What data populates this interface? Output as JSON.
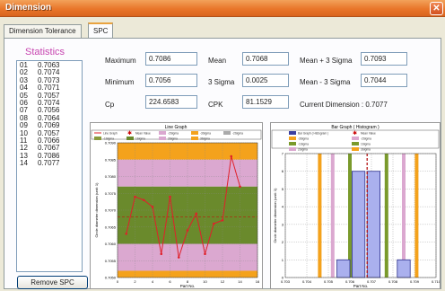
{
  "window": {
    "title": "Dimension",
    "close_glyph": "✕"
  },
  "tabs": [
    {
      "label": "Dimension Tolerance"
    },
    {
      "label": "SPC"
    }
  ],
  "statistics": {
    "title": "Statistics",
    "items": [
      {
        "idx": "01",
        "value": "0.7063"
      },
      {
        "idx": "02",
        "value": "0.7074"
      },
      {
        "idx": "03",
        "value": "0.7073"
      },
      {
        "idx": "04",
        "value": "0.7071"
      },
      {
        "idx": "05",
        "value": "0.7057"
      },
      {
        "idx": "06",
        "value": "0.7074"
      },
      {
        "idx": "07",
        "value": "0.7056"
      },
      {
        "idx": "08",
        "value": "0.7064"
      },
      {
        "idx": "09",
        "value": "0.7069"
      },
      {
        "idx": "10",
        "value": "0.7057"
      },
      {
        "idx": "11",
        "value": "0.7066"
      },
      {
        "idx": "12",
        "value": "0.7067"
      },
      {
        "idx": "13",
        "value": "0.7086"
      },
      {
        "idx": "14",
        "value": "0.7077"
      }
    ],
    "remove_label": "Remove SPC"
  },
  "metrics": {
    "maximum": {
      "label": "Maximum",
      "value": "0.7086"
    },
    "minimum": {
      "label": "Minimum",
      "value": "0.7056"
    },
    "cp": {
      "label": "Cp",
      "value": "224.6583"
    },
    "mean": {
      "label": "Mean",
      "value": "0.7068"
    },
    "sigma3": {
      "label": "3 Sigma",
      "value": "0.0025"
    },
    "cpk": {
      "label": "CPK",
      "value": "81.1529"
    },
    "mean_plus": {
      "label": "Mean + 3 Sigma",
      "value": "0.7093"
    },
    "mean_minus": {
      "label": "Mean - 3 Sigma",
      "value": "0.7044"
    },
    "current": {
      "label": "Current Dimension : 0.7077"
    }
  },
  "chart_data": [
    {
      "type": "line",
      "title": "Line Graph",
      "xlabel": "Part No.",
      "ylabel": "Circle diameter dimension (unit: 1)",
      "xlim": [
        0,
        16
      ],
      "ylim": [
        0.705,
        0.709
      ],
      "x_ticks": [
        "0",
        "2",
        "4",
        "6",
        "8",
        "10",
        "12",
        "14",
        "16"
      ],
      "y_ticks": [
        "0.7090",
        "0.7085",
        "0.7080",
        "0.7075",
        "0.7070",
        "0.7065",
        "0.7060",
        "0.7055",
        "0.7050"
      ],
      "x": [
        1,
        2,
        3,
        4,
        5,
        6,
        7,
        8,
        9,
        10,
        11,
        12,
        13,
        14
      ],
      "series": [
        {
          "name": "Line Graph",
          "values": [
            0.7063,
            0.7074,
            0.7073,
            0.7071,
            0.7057,
            0.7074,
            0.7056,
            0.7064,
            0.7069,
            0.7057,
            0.7066,
            0.7067,
            0.7086,
            0.7077
          ],
          "color": "#e0202a"
        }
      ],
      "mean_line": 0.7068,
      "bands": [
        {
          "from": 0.7085,
          "to": 0.709,
          "color": "#f4a21c"
        },
        {
          "from": 0.7077,
          "to": 0.7085,
          "color": "#dba8d0"
        },
        {
          "from": 0.706,
          "to": 0.7077,
          "color": "#6a8a2c"
        },
        {
          "from": 0.7052,
          "to": 0.706,
          "color": "#dba8d0"
        },
        {
          "from": 0.705,
          "to": 0.7052,
          "color": "#f4a21c"
        }
      ],
      "legend": [
        {
          "label": "Line Graph",
          "color": "#e0202a",
          "kind": "line"
        },
        {
          "label": "Mean Value",
          "color": "#cc0000",
          "kind": "marker"
        },
        {
          "label": "-2Sigma",
          "color": "#dba8d0",
          "kind": "swatch"
        },
        {
          "label": "-3Sigma",
          "color": "#f4a21c",
          "kind": "swatch"
        },
        {
          "label": "-2Sigma",
          "color": "#aaaaaa",
          "kind": "swatch"
        },
        {
          "label": "-1Sigma",
          "color": "#8a9a3c",
          "kind": "swatch"
        },
        {
          "label": "1Sigma",
          "color": "#6a8a2c",
          "kind": "swatch"
        },
        {
          "label": "2Sigma",
          "color": "#dba8d0",
          "kind": "swatch"
        },
        {
          "label": "3Sigma",
          "color": "#f4a21c",
          "kind": "swatch"
        }
      ]
    },
    {
      "type": "bar",
      "title": "Bar Graph ( Histogram )",
      "xlabel": "Part No.",
      "ylabel": "Circle diameter dimension (unit: 1)",
      "xlim": [
        0.703,
        0.71
      ],
      "ylim": [
        0,
        7
      ],
      "x_ticks": [
        "0.703",
        "0.704",
        "0.705",
        "0.706",
        "0.707",
        "0.708",
        "0.709",
        "0.710"
      ],
      "y_ticks": [
        "7",
        "6",
        "5",
        "4",
        "3",
        "2",
        "1",
        "0"
      ],
      "bins": [
        {
          "center": 0.7057,
          "count": 1
        },
        {
          "center": 0.7064,
          "count": 6
        },
        {
          "center": 0.7071,
          "count": 6
        },
        {
          "center": 0.7085,
          "count": 1
        }
      ],
      "mean_line": 0.7068,
      "sigma_lines": [
        {
          "x": 0.7046,
          "color": "#f4a21c"
        },
        {
          "x": 0.7052,
          "color": "#dba8d0"
        },
        {
          "x": 0.706,
          "color": "#7a9a2c"
        },
        {
          "x": 0.7077,
          "color": "#7a9a2c"
        },
        {
          "x": 0.7085,
          "color": "#dba8d0"
        },
        {
          "x": 0.7091,
          "color": "#f4a21c"
        }
      ],
      "legend": [
        {
          "label": "Bar Graph ( Histogram )",
          "color": "#3b3fa0",
          "kind": "swatch"
        },
        {
          "label": "Mean Value",
          "color": "#cc0000",
          "kind": "marker"
        },
        {
          "label": "-3Sigma",
          "color": "#f4a21c",
          "kind": "swatch"
        },
        {
          "label": "-2Sigma",
          "color": "#dba8d0",
          "kind": "swatch"
        },
        {
          "label": "-1Sigma",
          "color": "#7a9a2c",
          "kind": "swatch"
        },
        {
          "label": "1Sigma",
          "color": "#7a9a2c",
          "kind": "swatch"
        },
        {
          "label": "2Sigma",
          "color": "#dba8d0",
          "kind": "swatch"
        },
        {
          "label": "3Sigma",
          "color": "#f4a21c",
          "kind": "swatch"
        }
      ]
    }
  ]
}
